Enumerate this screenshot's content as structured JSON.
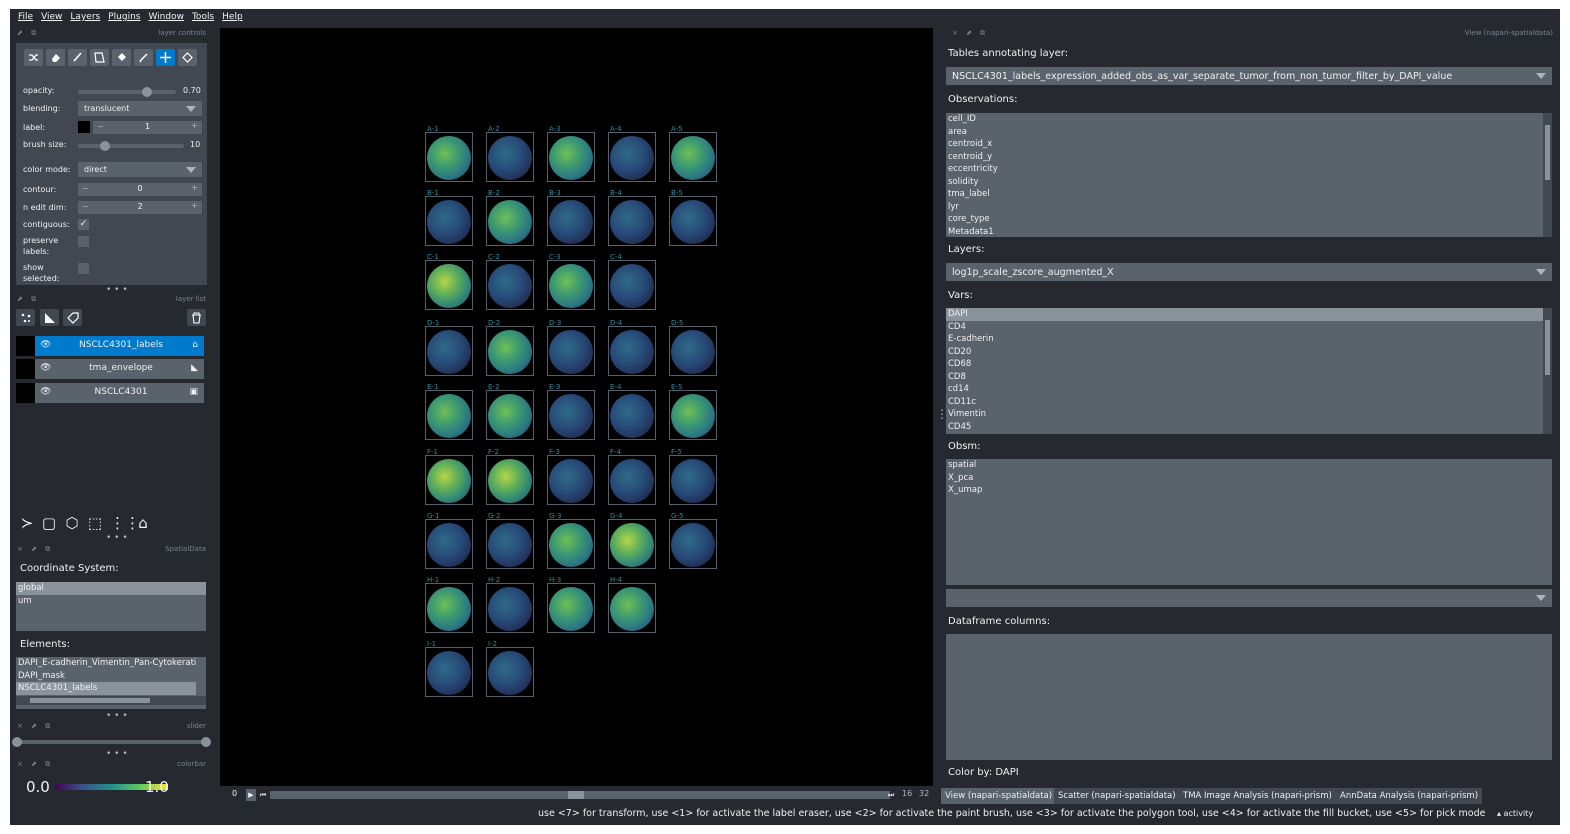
{
  "menu": [
    "File",
    "View",
    "Layers",
    "Plugins",
    "Window",
    "Tools",
    "Help"
  ],
  "layer_controls": {
    "title": "layer controls",
    "tools": [
      "shuffle-icon",
      "eraser-icon",
      "paint-brush-icon",
      "polygon-icon",
      "fill-bucket-icon",
      "picker-icon",
      "move-icon",
      "transform-icon"
    ],
    "opacity_label": "opacity:",
    "opacity_value": "0.70",
    "opacity_level": 0.7,
    "blending_label": "blending:",
    "blending_value": "translucent",
    "label_label": "label:",
    "label_value": "1",
    "brush_label": "brush size:",
    "brush_value": "10",
    "brush_level": 0.25,
    "color_mode_label": "color mode:",
    "color_mode_value": "direct",
    "contour_label": "contour:",
    "contour_value": "0",
    "n_edit_label": "n edit dim:",
    "n_edit_value": "2",
    "contiguous_label": "contiguous:",
    "preserve_label_1": "preserve",
    "preserve_label_2": "labels:",
    "show_label_1": "show",
    "show_label_2": "selected:"
  },
  "layer_list": {
    "title": "layer list",
    "layers": [
      {
        "name": "NSCLC4301_labels",
        "icon": "label-tag-icon",
        "selected": true
      },
      {
        "name": "tma_envelope",
        "icon": "shapes-icon",
        "selected": false
      },
      {
        "name": "NSCLC4301",
        "icon": "image-icon",
        "selected": false
      }
    ]
  },
  "spatialdata": {
    "title": "SpatialData",
    "coord_label": "Coordinate System:",
    "coords": [
      "global",
      "um"
    ],
    "elements_label": "Elements:",
    "elements": [
      "DAPI_E-cadherin_Vimentin_Pan-Cytokerati",
      "DAPI_mask",
      "NSCLC4301_labels"
    ]
  },
  "slider_title": "slider",
  "colorbar": {
    "title": "colorbar",
    "min": "0.0",
    "max": "1.0"
  },
  "canvas": {
    "rows": [
      [
        "A-1",
        "A-2",
        "A-3",
        "A-4",
        "A-5"
      ],
      [
        "B-1",
        "B-2",
        "B-3",
        "B-4",
        "B-5"
      ],
      [
        "C-1",
        "C-2",
        "C-3",
        "C-4"
      ],
      [
        "D-1",
        "D-2",
        "D-3",
        "D-4",
        "D-5"
      ],
      [
        "E-1",
        "E-2",
        "E-3",
        "E-4",
        "E-5"
      ],
      [
        "F-1",
        "F-2",
        "F-3",
        "F-4",
        "F-5"
      ],
      [
        "G-1",
        "G-2",
        "G-3",
        "G-4",
        "G-5"
      ],
      [
        "H-1",
        "H-2",
        "H-3",
        "H-4"
      ],
      [
        "I-1",
        "I-2"
      ]
    ],
    "dim_left": "0",
    "dim_current": "16",
    "dim_total": "32"
  },
  "right_panel": {
    "title": "View (napari-spatialdata)",
    "tables_label": "Tables annotating layer:",
    "table_value": "NSCLC4301_labels_expression_added_obs_as_var_separate_tumor_from_non_tumor_filter_by_DAPI_value",
    "obs_label": "Observations:",
    "obs": [
      "cell_ID",
      "area",
      "centroid_x",
      "centroid_y",
      "eccentricity",
      "solidity",
      "tma_label",
      "lyr",
      "core_type",
      "Metadata1"
    ],
    "layers_label": "Layers:",
    "layer_value": "log1p_scale_zscore_augmented_X",
    "vars_label": "Vars:",
    "vars": [
      "DAPI",
      "CD4",
      "E-cadherin",
      "CD20",
      "CD68",
      "CD8",
      "cd14",
      "CD11c",
      "Vimentin",
      "CD45"
    ],
    "obsm_label": "Obsm:",
    "obsm": [
      "spatial",
      "X_pca",
      "X_umap"
    ],
    "df_label": "Dataframe columns:",
    "color_by": "Color by: DAPI"
  },
  "tabs": [
    "View (napari-spatialdata)",
    "Scatter (napari-spatialdata)",
    "TMA Image Analysis (napari-prism)",
    "AnnData Analysis (napari-prism)"
  ],
  "status": "use <7> for transform, use <1> for activate the label eraser, use <2> for activate the paint brush, use <3> for activate the polygon tool, use <4> for activate the fill bucket, use <5> for pick mode",
  "activity": "▴ activity"
}
